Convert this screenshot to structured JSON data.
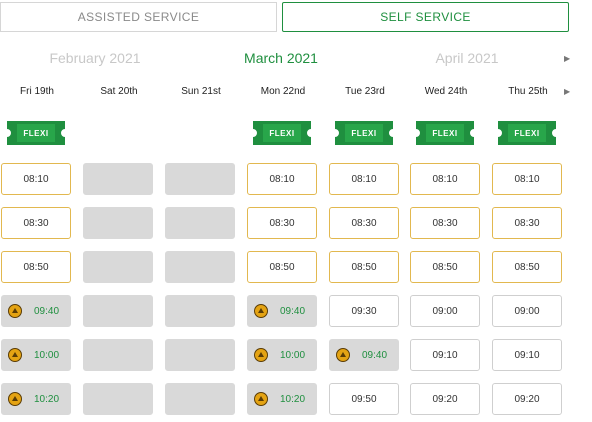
{
  "tabs": {
    "assisted": "ASSISTED SERVICE",
    "self": "SELF SERVICE"
  },
  "months": {
    "prev": "February 2021",
    "current": "March 2021",
    "next": "April 2021"
  },
  "flexi_label": "FLEXI",
  "colors": {
    "accent": "#1f8f3f",
    "available_border": "#e2b84f",
    "unavailable_bg": "#d9d9d9",
    "priority_icon": "#e4a313"
  },
  "days": [
    {
      "label": "Fri 19th",
      "flexi": true,
      "slots": [
        {
          "type": "avail",
          "time": "08:10"
        },
        {
          "type": "avail",
          "time": "08:30"
        },
        {
          "type": "avail",
          "time": "08:50"
        },
        {
          "type": "priority",
          "time": "09:40"
        },
        {
          "type": "priority",
          "time": "10:00"
        },
        {
          "type": "priority",
          "time": "10:20"
        }
      ]
    },
    {
      "label": "Sat 20th",
      "flexi": false,
      "slots": [
        {
          "type": "empty",
          "time": ""
        },
        {
          "type": "empty",
          "time": ""
        },
        {
          "type": "empty",
          "time": ""
        },
        {
          "type": "empty",
          "time": ""
        },
        {
          "type": "empty",
          "time": ""
        },
        {
          "type": "empty",
          "time": ""
        }
      ]
    },
    {
      "label": "Sun 21st",
      "flexi": false,
      "slots": [
        {
          "type": "empty",
          "time": ""
        },
        {
          "type": "empty",
          "time": ""
        },
        {
          "type": "empty",
          "time": ""
        },
        {
          "type": "empty",
          "time": ""
        },
        {
          "type": "empty",
          "time": ""
        },
        {
          "type": "empty",
          "time": ""
        }
      ]
    },
    {
      "label": "Mon 22nd",
      "flexi": true,
      "slots": [
        {
          "type": "avail",
          "time": "08:10"
        },
        {
          "type": "avail",
          "time": "08:30"
        },
        {
          "type": "avail",
          "time": "08:50"
        },
        {
          "type": "priority",
          "time": "09:40"
        },
        {
          "type": "priority",
          "time": "10:00"
        },
        {
          "type": "priority",
          "time": "10:20"
        }
      ]
    },
    {
      "label": "Tue 23rd",
      "flexi": true,
      "slots": [
        {
          "type": "avail",
          "time": "08:10"
        },
        {
          "type": "avail",
          "time": "08:30"
        },
        {
          "type": "avail",
          "time": "08:50"
        },
        {
          "type": "plain",
          "time": "09:30"
        },
        {
          "type": "priority",
          "time": "09:40"
        },
        {
          "type": "plain",
          "time": "09:50"
        }
      ]
    },
    {
      "label": "Wed 24th",
      "flexi": true,
      "slots": [
        {
          "type": "avail",
          "time": "08:10"
        },
        {
          "type": "avail",
          "time": "08:30"
        },
        {
          "type": "avail",
          "time": "08:50"
        },
        {
          "type": "plain",
          "time": "09:00"
        },
        {
          "type": "plain",
          "time": "09:10"
        },
        {
          "type": "plain",
          "time": "09:20"
        }
      ]
    },
    {
      "label": "Thu 25th",
      "flexi": true,
      "slots": [
        {
          "type": "avail",
          "time": "08:10"
        },
        {
          "type": "avail",
          "time": "08:30"
        },
        {
          "type": "avail",
          "time": "08:50"
        },
        {
          "type": "plain",
          "time": "09:00"
        },
        {
          "type": "plain",
          "time": "09:10"
        },
        {
          "type": "plain",
          "time": "09:20"
        }
      ]
    }
  ]
}
